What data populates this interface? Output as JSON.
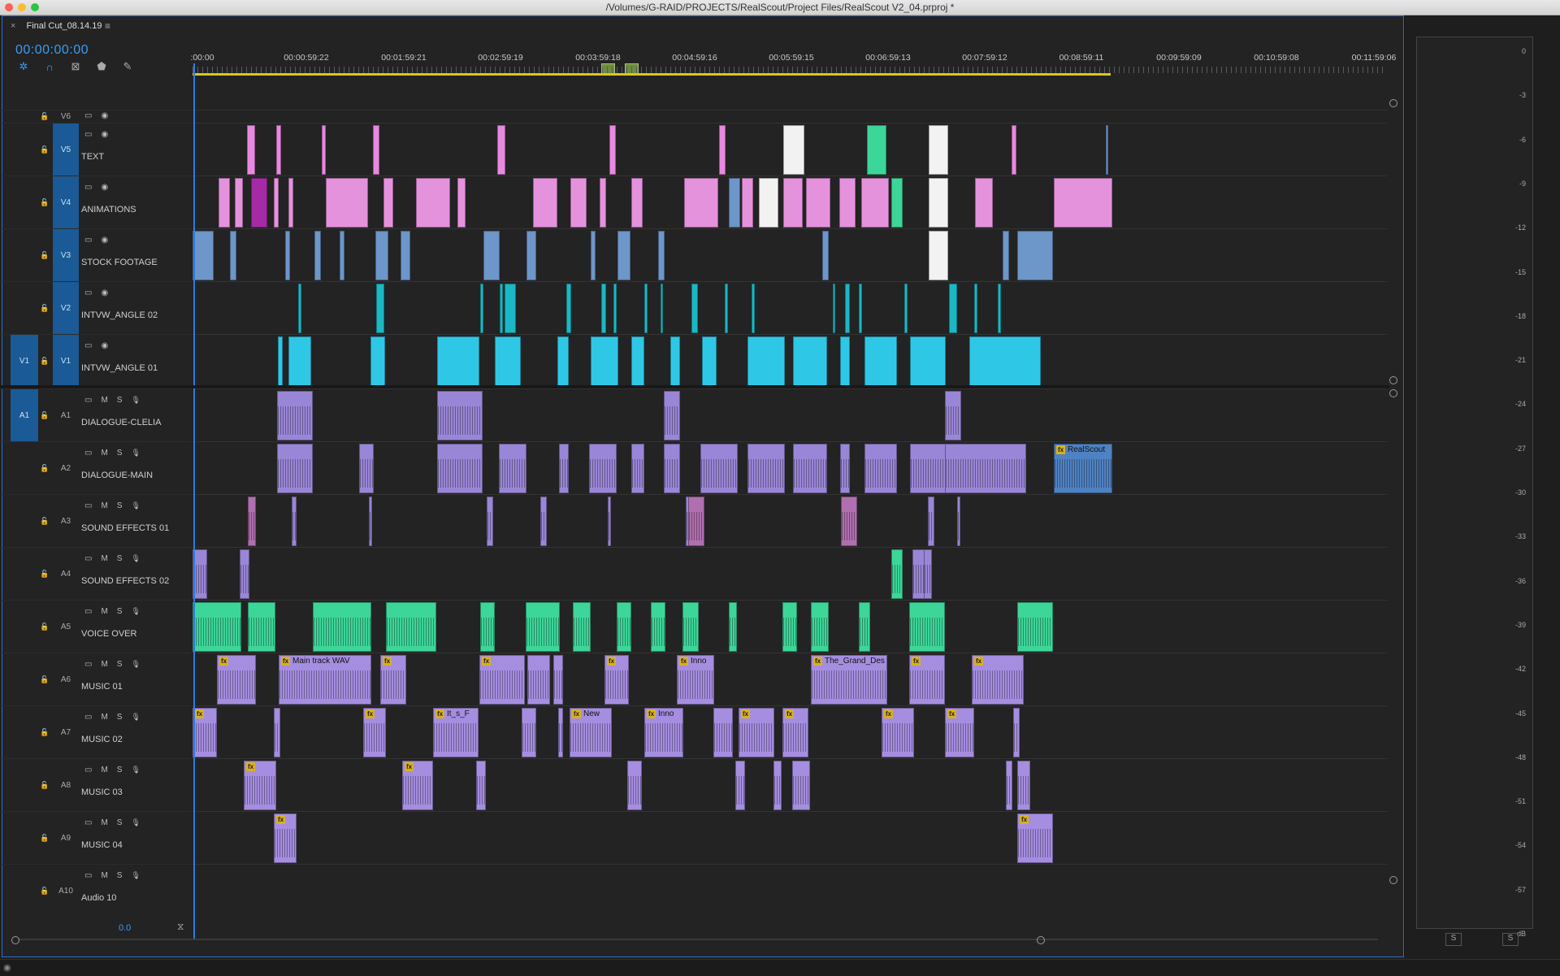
{
  "window": {
    "title": "/Volumes/G-RAID/PROJECTS/RealScout/Project Files/RealScout V2_04.prproj *",
    "traffic_colors": [
      "#ff5f57",
      "#febc2e",
      "#28c840"
    ]
  },
  "sequence": {
    "tab_name": "Final Cut_08.14.19",
    "timecode": "00:00:00:00",
    "menu_glyph": "≡",
    "zoom_value": "0.0"
  },
  "ruler": {
    "labels": [
      ":00:00",
      "00:00:59:22",
      "00:01:59:21",
      "00:02:59:19",
      "00:03:59:18",
      "00:04:59:16",
      "00:05:59:15",
      "00:06:59:13",
      "00:07:59:12",
      "00:08:59:11",
      "00:09:59:09",
      "00:10:59:08",
      "00:11:59:06"
    ]
  },
  "video_tracks": [
    {
      "id": "V6",
      "name": ""
    },
    {
      "id": "V5",
      "name": "TEXT"
    },
    {
      "id": "V4",
      "name": "ANIMATIONS"
    },
    {
      "id": "V3",
      "name": "STOCK FOOTAGE"
    },
    {
      "id": "V2",
      "name": "INTVW_ANGLE 02"
    },
    {
      "id": "V1",
      "name": "INTVW_ANGLE 01",
      "source": "V1"
    }
  ],
  "audio_tracks": [
    {
      "id": "A1",
      "name": "DIALOGUE-CLELIA",
      "source": "A1"
    },
    {
      "id": "A2",
      "name": "DIALOGUE-MAIN"
    },
    {
      "id": "A3",
      "name": "SOUND EFFECTS 01"
    },
    {
      "id": "A4",
      "name": "SOUND EFFECTS 02"
    },
    {
      "id": "A5",
      "name": "VOICE OVER"
    },
    {
      "id": "A6",
      "name": "MUSIC 01"
    },
    {
      "id": "A7",
      "name": "MUSIC 02"
    },
    {
      "id": "A8",
      "name": "MUSIC 03"
    },
    {
      "id": "A9",
      "name": "MUSIC 04"
    },
    {
      "id": "A10",
      "name": "Audio 10"
    }
  ],
  "audio_track_buttons": {
    "mute": "M",
    "solo": "S"
  },
  "clip_names": {
    "realscout": "RealScout",
    "main_track": "Main track WAV",
    "inno": "Inno",
    "grand": "The_Grand_Des",
    "its": "It_s_F",
    "new": "New",
    "inno2": "Inno",
    "fx": "fx"
  },
  "colors": {
    "text_clip": "#e889e0",
    "animation_clip": "#e592dd",
    "stock_clip": "#6d96c9",
    "intvw2_clip": "#1ab8c4",
    "intvw1_clip": "#2ec8e6",
    "dialogue_clip": "#9a86d6",
    "sfx_clip": "#9a86d6",
    "voice_clip": "#3dd699",
    "music_clip": "#a58ee0",
    "accent": "#3a9cf5"
  },
  "meter": {
    "db_labels": [
      "0",
      "-3",
      "-6",
      "-9",
      "-12",
      "-15",
      "-18",
      "-21",
      "-24",
      "-27",
      "-30",
      "-33",
      "-36",
      "-39",
      "-42",
      "-45",
      "-48",
      "-51",
      "-54",
      "-57",
      "dB"
    ],
    "solo_labels": [
      "S",
      "S"
    ]
  }
}
